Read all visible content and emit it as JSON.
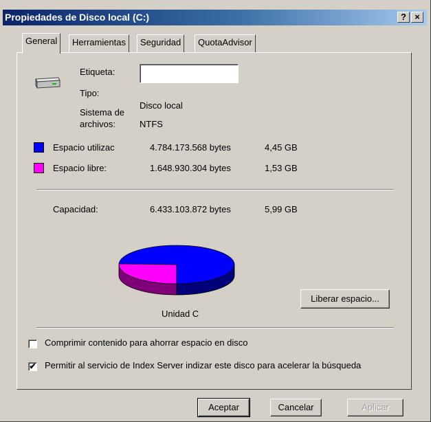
{
  "window": {
    "title": "Propiedades de Disco local (C:)",
    "help_button": "?",
    "close_button": "×"
  },
  "tabs": [
    {
      "label": "General",
      "active": true
    },
    {
      "label": "Herramientas",
      "active": false
    },
    {
      "label": "Seguridad",
      "active": false
    },
    {
      "label": "QuotaAdvisor",
      "active": false
    }
  ],
  "general": {
    "drive_icon": "hard-drive-icon",
    "label_caption": "Etiqueta:",
    "label_value": "",
    "type_caption": "Tipo:",
    "type_value": "Disco local",
    "fs_caption_line1": "Sistema de",
    "fs_caption_line2": "archivos:",
    "fs_value": "NTFS",
    "used": {
      "caption": "Espacio utilizac",
      "bytes": "4.784.173.568 bytes",
      "size": "4,45 GB",
      "color": "#0000ff"
    },
    "free": {
      "caption": "Espacio libre:",
      "bytes": "1.648.930.304 bytes",
      "size": "1,53 GB",
      "color": "#ff00ff"
    },
    "capacity": {
      "caption": "Capacidad:",
      "bytes": "6.433.103.872 bytes",
      "size": "5,99 GB"
    },
    "chart_label": "Unidad C",
    "cleanup_button": "Liberar espacio...",
    "compress_checkbox": {
      "label": "Comprimir contenido para ahorrar espacio en disco",
      "checked": false
    },
    "index_checkbox": {
      "label": "Permitir al servicio de Index Server indizar este disco para acelerar la búsqueda",
      "checked": true
    }
  },
  "buttons": {
    "ok": "Aceptar",
    "cancel": "Cancelar",
    "apply": "Aplicar"
  },
  "colors": {
    "titlebar_start": "#0a246a",
    "titlebar_end": "#a6caf0",
    "used_space": "#0000ff",
    "free_space": "#ff00ff"
  }
}
